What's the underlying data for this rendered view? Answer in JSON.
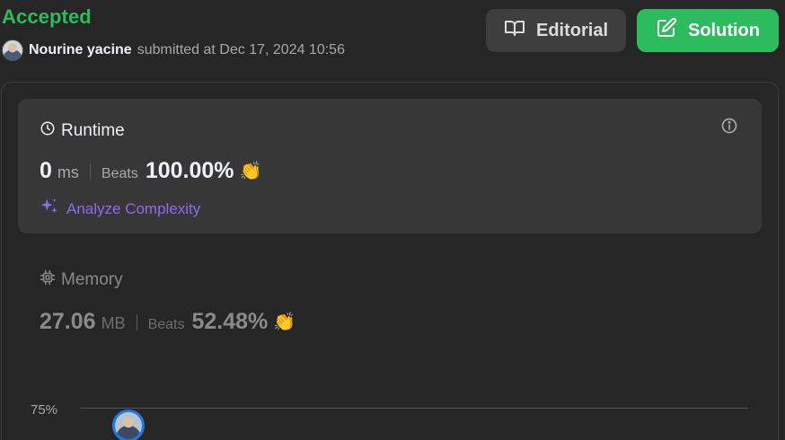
{
  "header": {
    "status": "Accepted",
    "user_name": "Nourine yacine",
    "submitted_text": "submitted at Dec 17, 2024 10:56",
    "editorial_label": "Editorial",
    "solution_label": "Solution"
  },
  "runtime": {
    "title": "Runtime",
    "value": "0",
    "unit": "ms",
    "beats_label": "Beats",
    "beats_pct": "100.00%",
    "analyze_label": "Analyze Complexity"
  },
  "memory": {
    "title": "Memory",
    "value": "27.06",
    "unit": "MB",
    "beats_label": "Beats",
    "beats_pct": "52.48%"
  },
  "chart": {
    "axis_label": "75%"
  },
  "colors": {
    "accent_green": "#2cbb5d",
    "analyze_purple": "#8b6cf0",
    "marker_blue": "#1f7ae0"
  }
}
